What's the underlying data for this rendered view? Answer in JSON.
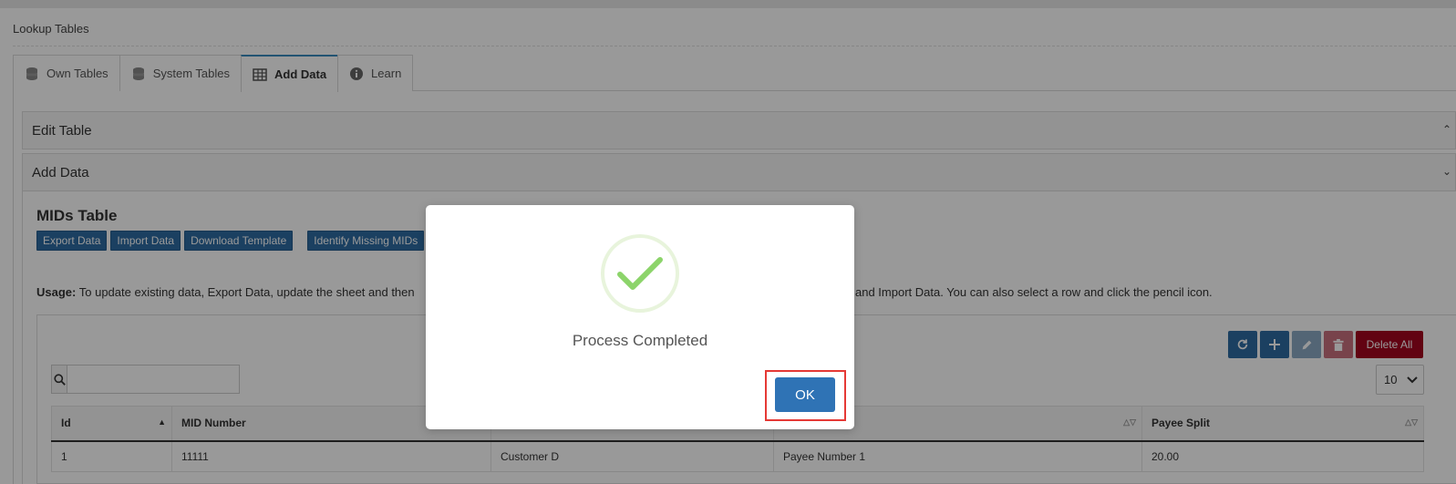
{
  "page": {
    "title": "Lookup Tables"
  },
  "tabs": [
    {
      "label": "Own Tables",
      "icon": "database-icon"
    },
    {
      "label": "System Tables",
      "icon": "database-icon"
    },
    {
      "label": "Add Data",
      "icon": "table-icon",
      "active": true
    },
    {
      "label": "Learn",
      "icon": "info-icon"
    }
  ],
  "panels": {
    "edit_table": "Edit Table",
    "add_data": "Add Data"
  },
  "mids": {
    "title": "MIDs Table",
    "buttons": [
      "Export Data",
      "Import Data",
      "Download Template",
      "Identify Missing MIDs"
    ],
    "usage_label": "Usage:",
    "usage_left": "To update existing data, Export Data, update the sheet and then",
    "usage_right": "and Import Data. You can also select a row and click the pencil icon."
  },
  "toolbar": {
    "delete_all": "Delete All",
    "page_size": "10",
    "search_value": ""
  },
  "table": {
    "columns": [
      "Id",
      "MID Number",
      "",
      "",
      "Payee Split"
    ],
    "rows": [
      [
        "1",
        "11111",
        "Customer D",
        "Payee Number 1",
        "20.00"
      ]
    ]
  },
  "modal": {
    "message": "Process Completed",
    "ok_label": "OK"
  },
  "colors": {
    "primary": "#2d6ca2",
    "danger": "#a3051f",
    "success": "#8cd46a",
    "highlight": "#e53935"
  }
}
